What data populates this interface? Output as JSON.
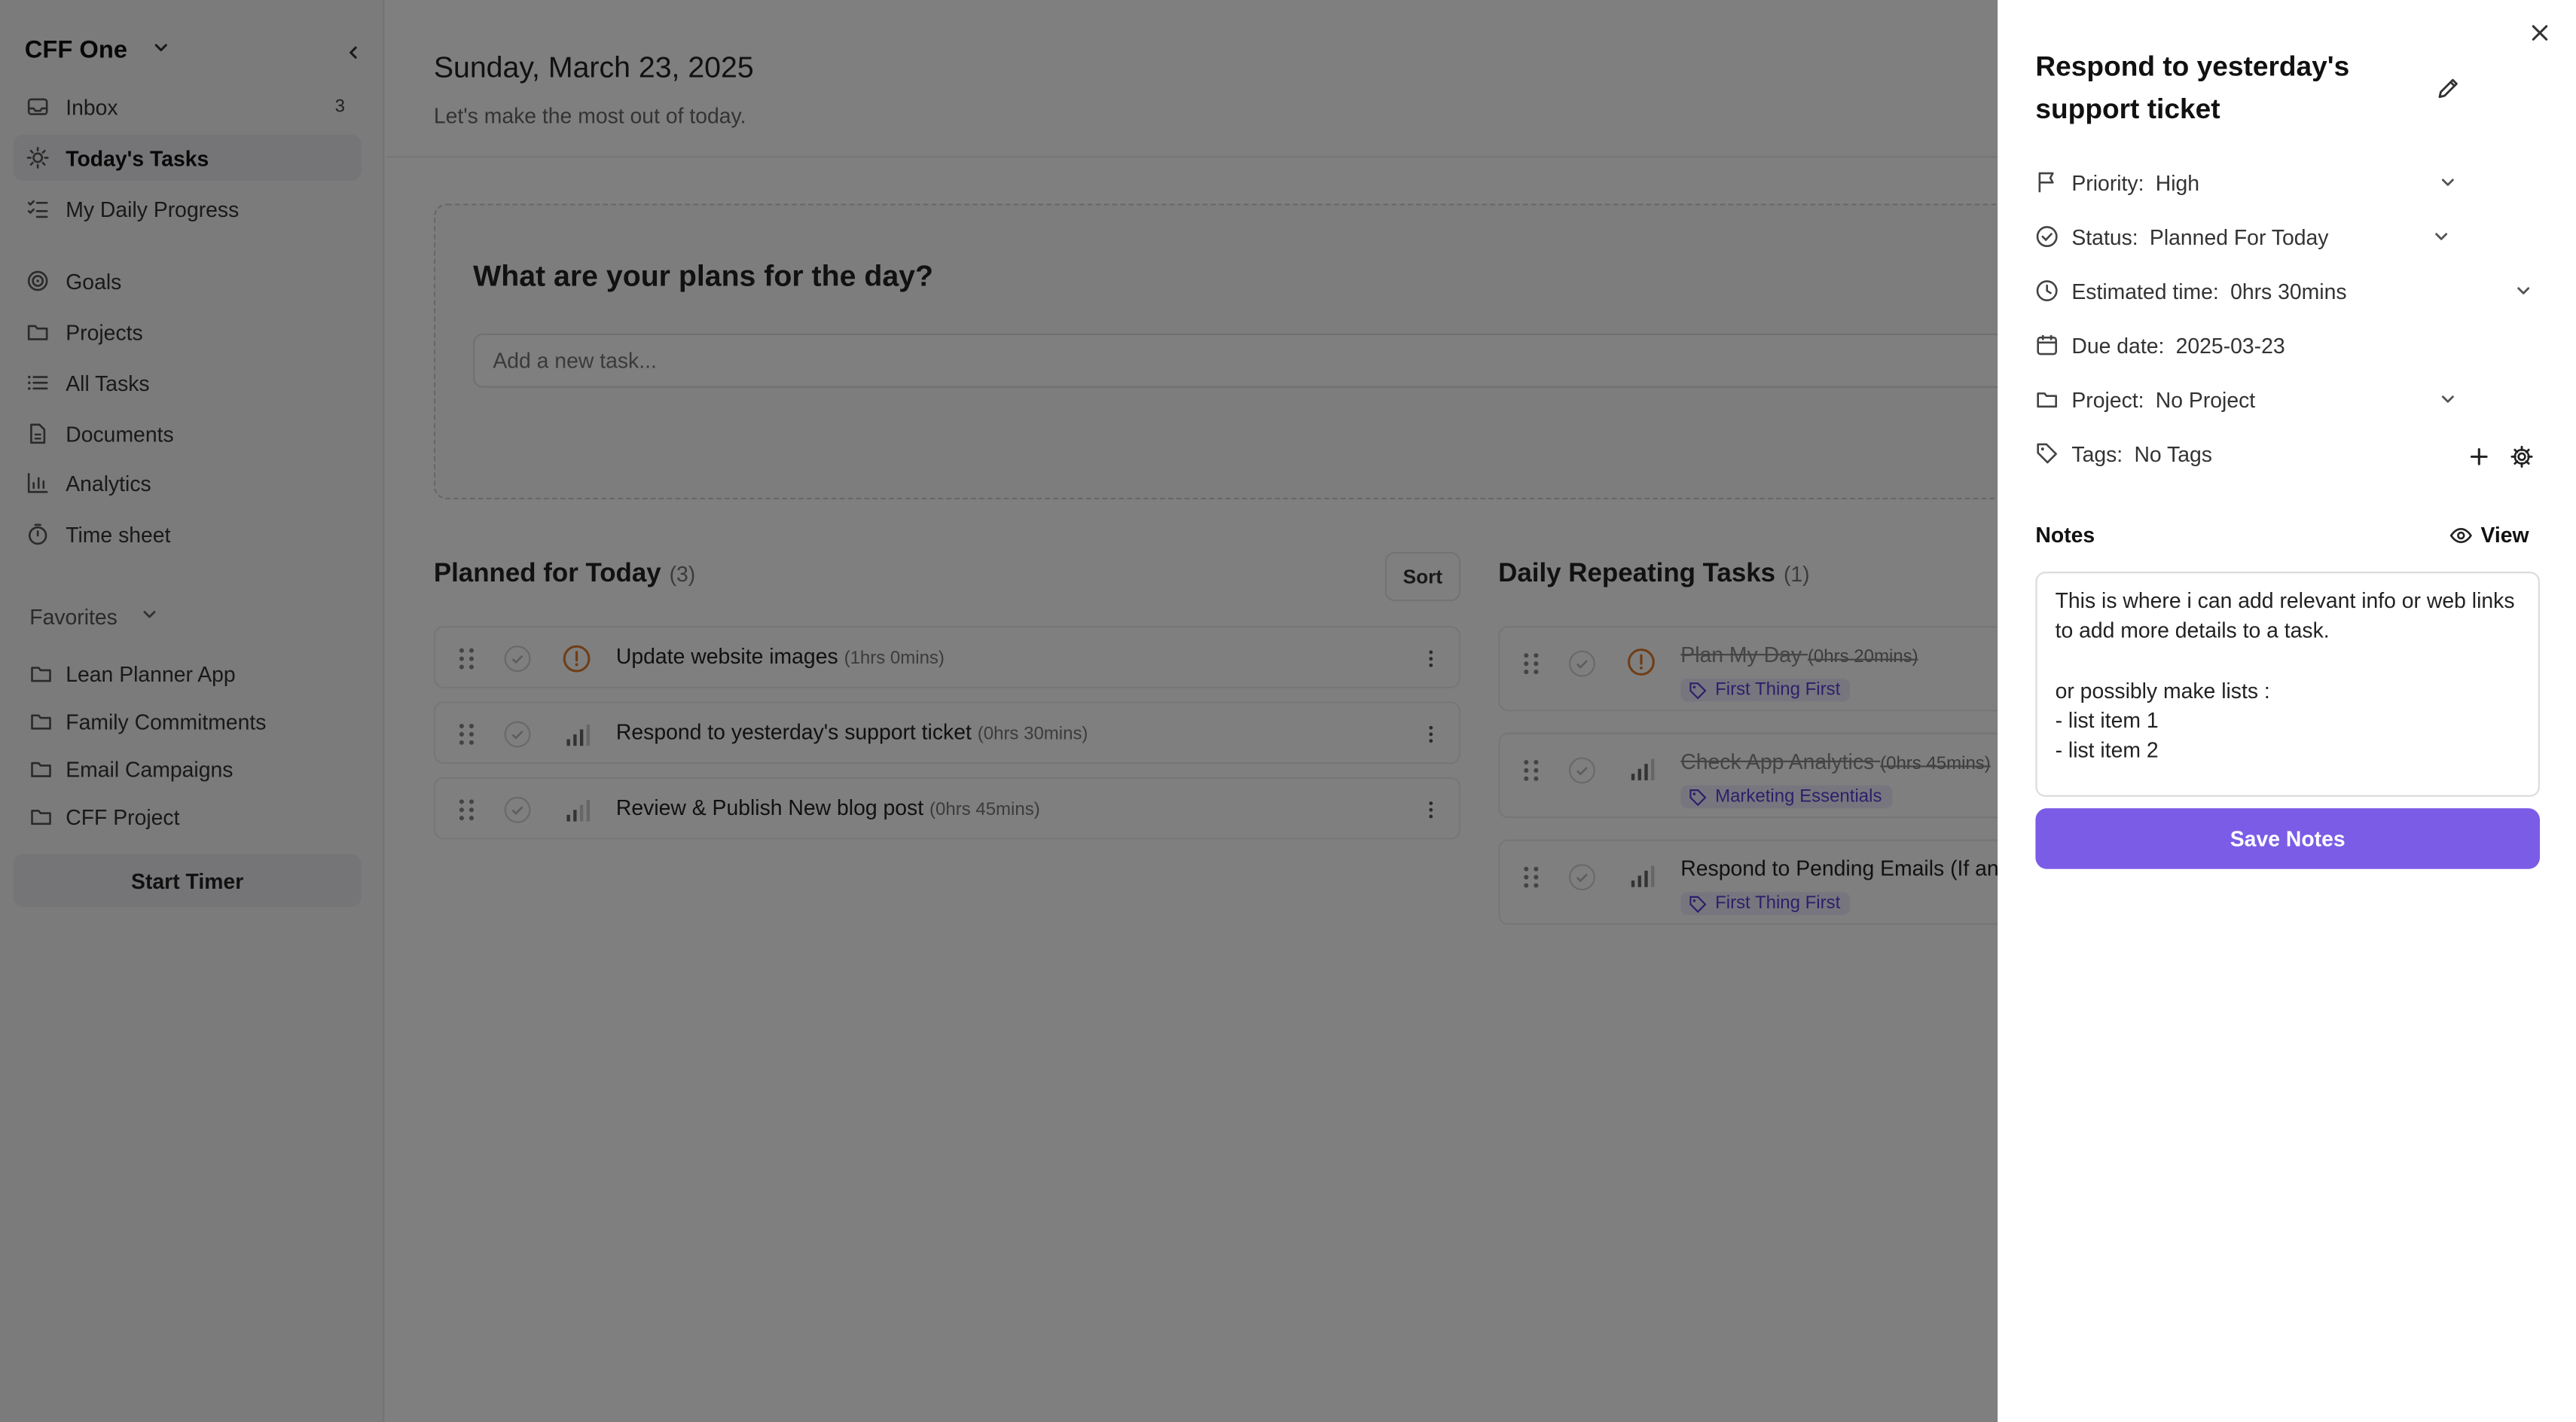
{
  "sidebar": {
    "workspace": "CFF One",
    "nav": [
      {
        "label": "Inbox",
        "count": "3",
        "icon": "inbox-icon"
      },
      {
        "label": "Today's Tasks",
        "icon": "sun-icon"
      },
      {
        "label": "My Daily Progress",
        "icon": "checklist-icon"
      },
      {
        "label": "Goals",
        "icon": "target-icon"
      },
      {
        "label": "Projects",
        "icon": "folder-icon"
      },
      {
        "label": "All Tasks",
        "icon": "list-icon"
      },
      {
        "label": "Documents",
        "icon": "document-icon"
      },
      {
        "label": "Analytics",
        "icon": "bar-chart-icon"
      },
      {
        "label": "Time sheet",
        "icon": "stopwatch-icon"
      }
    ],
    "favorites_label": "Favorites",
    "favorites": [
      "Lean Planner App",
      "Family Commitments",
      "Email Campaigns",
      "CFF Project"
    ],
    "start_timer": "Start Timer"
  },
  "main": {
    "date": "Sunday, March 23, 2025",
    "subtitle": "Let's make the most out of today.",
    "plan_title": "What are your plans for the day?",
    "task_placeholder": "Add a new task...",
    "planned": {
      "title": "Planned for Today",
      "count": "(3)",
      "sort": "Sort",
      "tasks": [
        {
          "title": "Update website images",
          "est": "(1hrs 0mins)"
        },
        {
          "title": "Respond to yesterday's support ticket",
          "est": "(0hrs 30mins)"
        },
        {
          "title": "Review & Publish New blog post",
          "est": "(0hrs 45mins)"
        }
      ]
    },
    "repeating": {
      "title": "Daily Repeating Tasks",
      "count": "(1)",
      "tasks": [
        {
          "title": "Plan My Day",
          "est": "(0hrs 20mins)",
          "tag": "First Thing First"
        },
        {
          "title": "Check App Analytics",
          "est": "(0hrs 45mins)",
          "tag": "Marketing Essentials"
        },
        {
          "title": "Respond to Pending Emails (If an",
          "tag": "First Thing First"
        }
      ]
    }
  },
  "panel": {
    "title": "Respond to yesterday's support ticket",
    "priority": {
      "label": "Priority:",
      "value": "High"
    },
    "status": {
      "label": "Status:",
      "value": "Planned For Today"
    },
    "estimated": {
      "label": "Estimated time:",
      "value": "0hrs 30mins"
    },
    "due": {
      "label": "Due date:",
      "value": "2025-03-23"
    },
    "project": {
      "label": "Project:",
      "value": "No Project"
    },
    "tags": {
      "label": "Tags:",
      "value": "No Tags"
    },
    "notes_label": "Notes",
    "view": "View",
    "notes": "This is where i can add relevant info or web links to add more details to a task.\n\nor possibly make lists :\n- list item 1\n- list item 2",
    "save": "Save Notes"
  },
  "colors": {
    "accent": "#7b5ce6",
    "priority_high": "#e07b2a",
    "tag_text": "#5b3fd6"
  }
}
